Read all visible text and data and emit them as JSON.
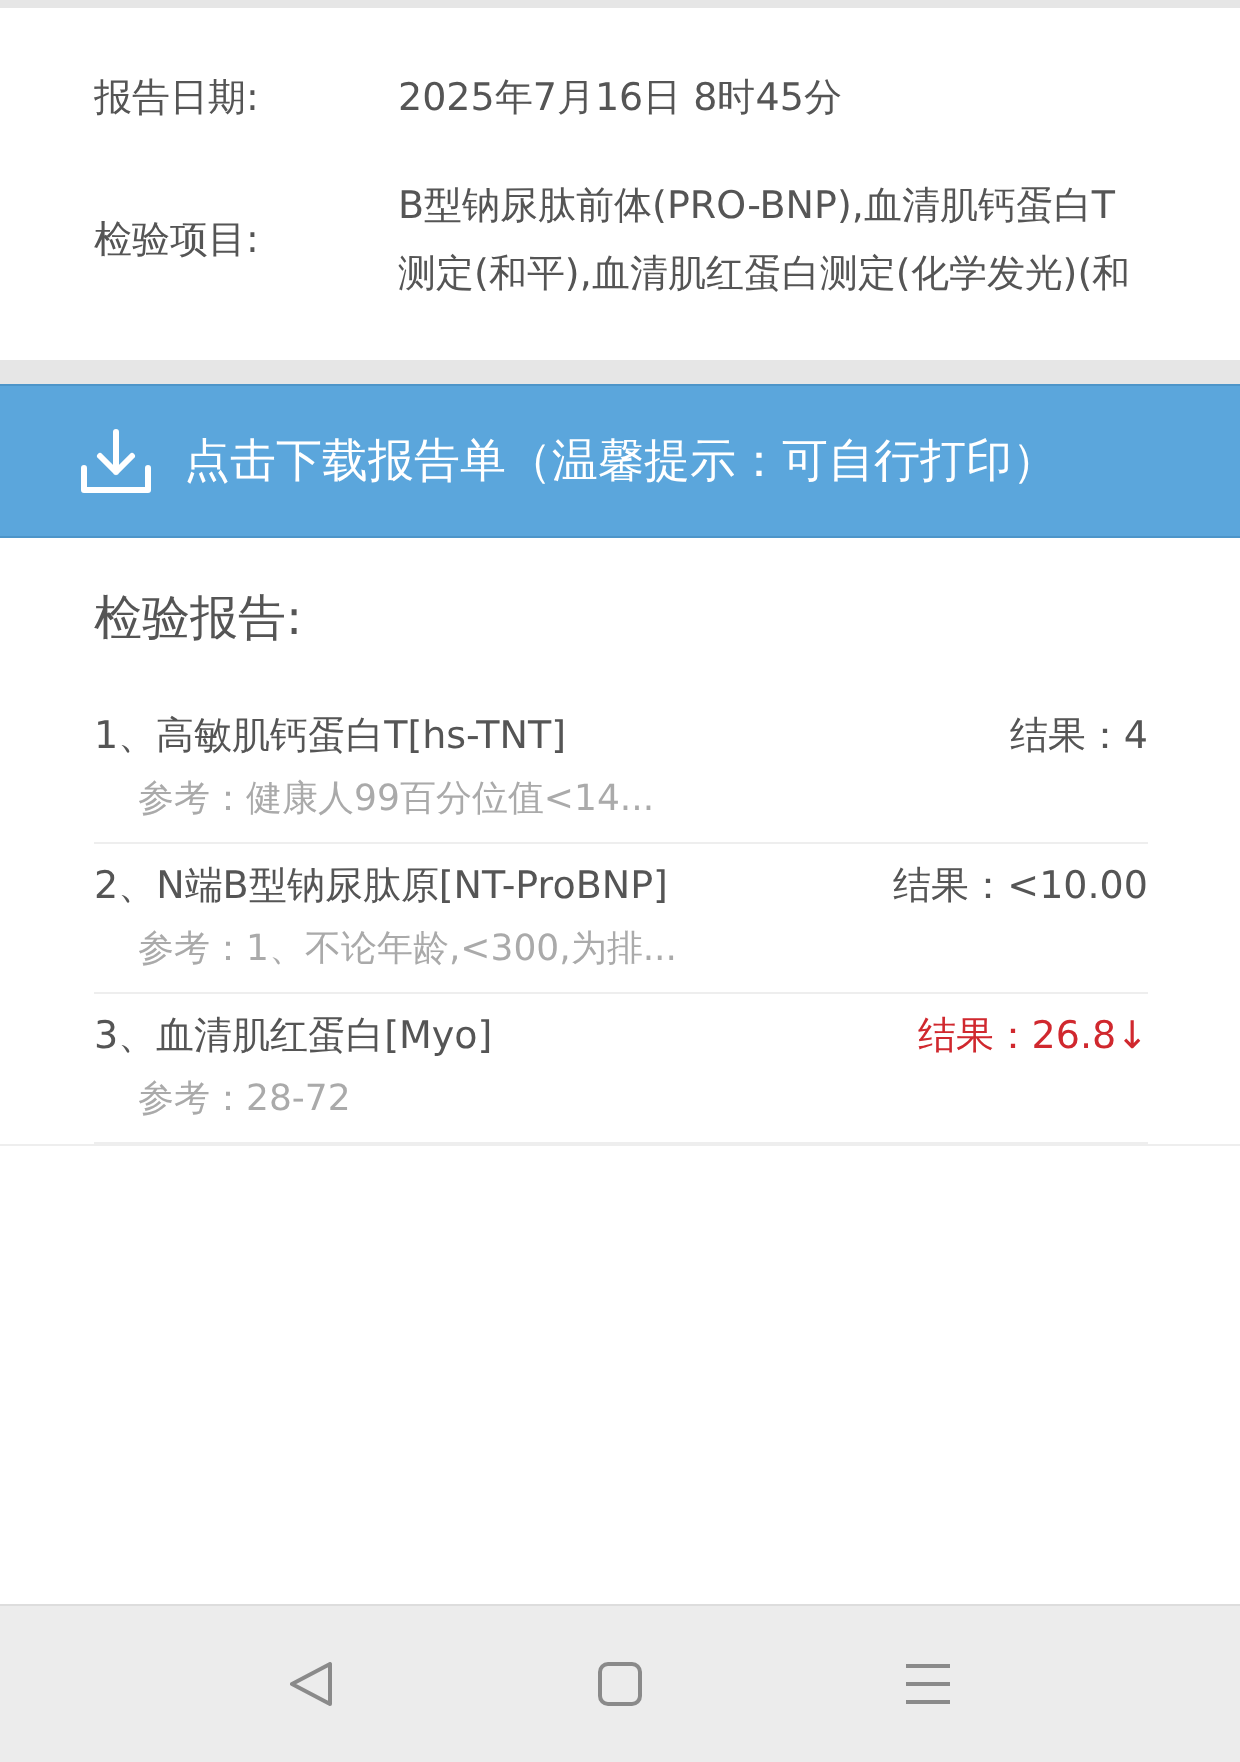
{
  "info": [
    {
      "label": "报告日期:",
      "value": "2025年7月16日 8时45分"
    },
    {
      "label": "检验项目:",
      "value": "B型钠尿肽前体(PRO-BNP),血清肌钙蛋白T测定(和平),血清肌红蛋白测定(化学发光)(和"
    }
  ],
  "download_button": {
    "label": "点击下载报告单（温馨提示：可自行打印）"
  },
  "report": {
    "title": "检验报告:",
    "items": [
      {
        "name": "1、高敏肌钙蛋白T[hs-TNT]",
        "result": "结果：4",
        "reference": "参考：健康人99百分位值<14...",
        "abnormal": false
      },
      {
        "name": "2、N端B型钠尿肽原[NT-ProBNP]",
        "result": "结果：<10.00",
        "reference": "参考：1、不论年龄,<300,为排...",
        "abnormal": false
      },
      {
        "name": "3、血清肌红蛋白[Myo]",
        "result": "结果：26.8↓",
        "reference": "参考：28-72",
        "abnormal": true
      }
    ]
  }
}
